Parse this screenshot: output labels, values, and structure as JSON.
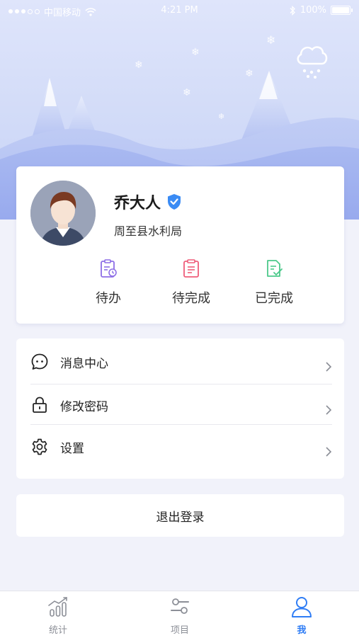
{
  "status_bar": {
    "carrier": "中国移动",
    "time": "4:21 PM",
    "battery": "100%"
  },
  "profile": {
    "name": "乔大人",
    "organization": "周至县水利局",
    "verified_icon": "verified-badge-icon",
    "avatar_icon": "user-avatar"
  },
  "quick_actions": [
    {
      "label": "待办",
      "icon": "clipboard-clock-icon",
      "color": "#8e6fe6"
    },
    {
      "label": "待完成",
      "icon": "clipboard-list-icon",
      "color": "#ef5d7a"
    },
    {
      "label": "已完成",
      "icon": "document-check-icon",
      "color": "#4cc98b"
    }
  ],
  "menu": {
    "items": [
      {
        "label": "消息中心",
        "icon": "chat-bubble-icon"
      },
      {
        "label": "修改密码",
        "icon": "lock-icon"
      },
      {
        "label": "设置",
        "icon": "gear-icon"
      }
    ]
  },
  "logout": {
    "label": "退出登录"
  },
  "tabs": [
    {
      "label": "统计",
      "icon": "chart-icon",
      "active": false
    },
    {
      "label": "项目",
      "icon": "sliders-icon",
      "active": false
    },
    {
      "label": "我",
      "icon": "person-icon",
      "active": true
    }
  ],
  "colors": {
    "accent": "#2f7df5",
    "verified": "#3a8bf4",
    "background": "#f1f2fa"
  }
}
